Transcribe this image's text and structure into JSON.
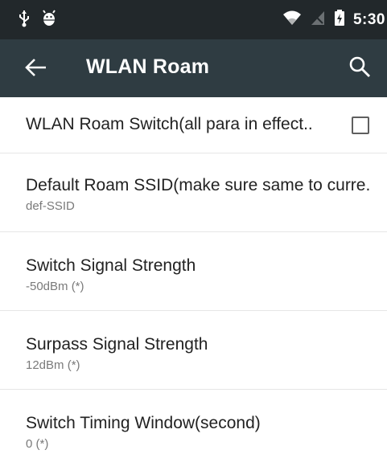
{
  "status_bar": {
    "time": "5:30",
    "icons_left": [
      "usb-icon",
      "android-debug-icon"
    ],
    "icons_right": [
      "wifi-icon",
      "no-signal-icon",
      "battery-charging-icon"
    ]
  },
  "app_bar": {
    "title": "WLAN Roam",
    "back_icon": "arrow-back-icon",
    "search_icon": "search-icon",
    "background": "#2f3c42"
  },
  "settings": [
    {
      "title": "WLAN Roam Switch(all para in effect..",
      "checked": false
    },
    {
      "title": "Default Roam SSID(make sure same to curre..",
      "summary": "def-SSID"
    },
    {
      "title": "Switch Signal Strength",
      "summary": "-50dBm (*)"
    },
    {
      "title": "Surpass Signal Strength",
      "summary": "12dBm (*)"
    },
    {
      "title": "Switch Timing Window(second)",
      "summary": "0 (*)"
    }
  ]
}
